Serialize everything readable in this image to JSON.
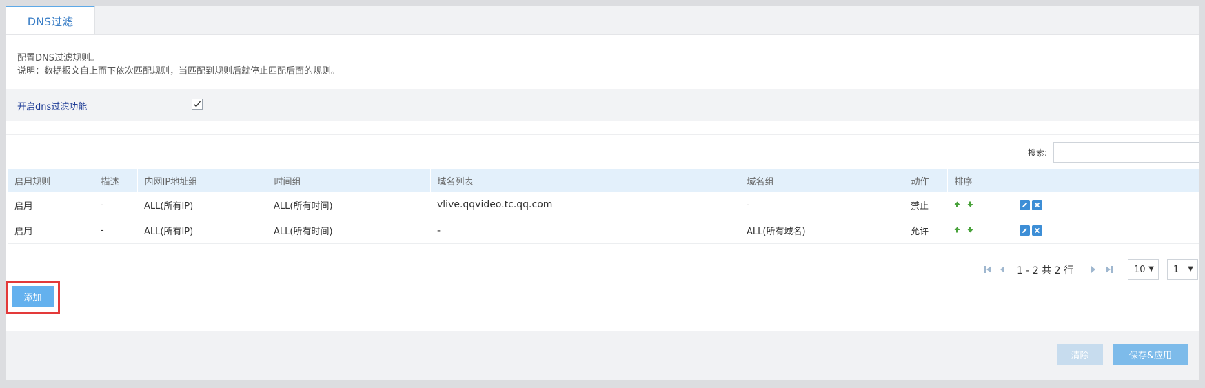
{
  "tabs": [
    {
      "label": "DNS过滤",
      "active": true
    }
  ],
  "description": {
    "line1": "配置DNS过滤规则。",
    "line2": "说明：数据报文自上而下依次匹配规则，当匹配到规则后就停止匹配后面的规则。"
  },
  "enable_dns_filter": {
    "label": "开启dns过滤功能",
    "checked": true
  },
  "search": {
    "label": "搜索:",
    "value": ""
  },
  "table": {
    "headers": [
      "启用规则",
      "描述",
      "内网IP地址组",
      "时间组",
      "域名列表",
      "域名组",
      "动作",
      "排序",
      ""
    ],
    "rows": [
      {
        "enabled": "启用",
        "description": "-",
        "ip_group": "ALL(所有IP)",
        "time_group": "ALL(所有时间)",
        "domain_list": "vlive.qqvideo.tc.qq.com",
        "domain_group": "-",
        "action": "禁止"
      },
      {
        "enabled": "启用",
        "description": "-",
        "ip_group": "ALL(所有IP)",
        "time_group": "ALL(所有时间)",
        "domain_list": "-",
        "domain_group": "ALL(所有域名)",
        "action": "允许"
      }
    ]
  },
  "pagination": {
    "info": "1 - 2 共 2 行",
    "page_size": "10",
    "page": "1"
  },
  "buttons": {
    "add": "添加",
    "clear": "清除",
    "save": "保存&应用"
  },
  "colors": {
    "accent": "#5ea9e7",
    "header_bg": "#e3f0fb",
    "highlight": "#e33a3a"
  },
  "icons": [
    "first-page-icon",
    "prev-page-icon",
    "next-page-icon",
    "last-page-icon",
    "move-up-icon",
    "move-down-icon",
    "edit-icon",
    "delete-icon",
    "check-icon"
  ]
}
